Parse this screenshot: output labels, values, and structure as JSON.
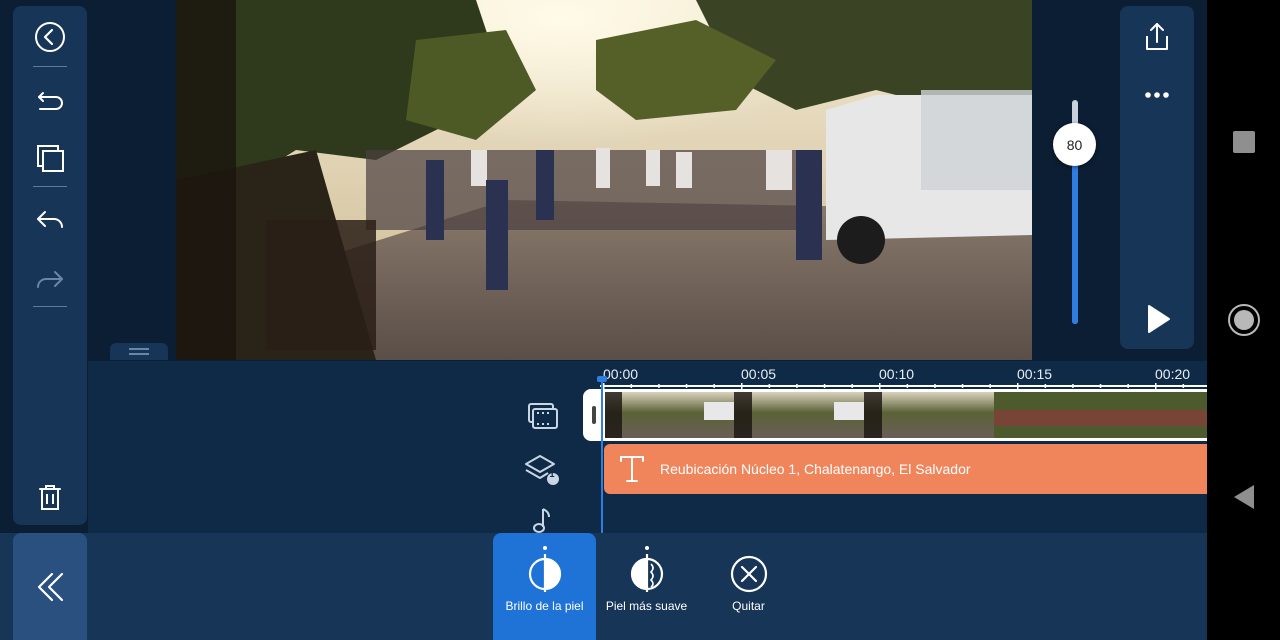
{
  "editor": {
    "left_toolbar": {
      "icons": [
        "back-circle-icon",
        "undo-icon",
        "duplicate-icon",
        "reply-icon",
        "redo-icon",
        "trash-icon"
      ]
    },
    "volume_slider": {
      "value": "80",
      "level_percent": 80
    },
    "right_toolbar": {
      "icons": [
        "share-export-icon",
        "more-options-icon",
        "play-icon"
      ]
    },
    "timeline": {
      "ruler_labels": [
        "00:00",
        "00:05",
        "00:10",
        "00:15",
        "00:20"
      ],
      "track_icons": [
        "media-track-icon",
        "layer-track-icon",
        "music-track-icon"
      ],
      "layer_badge": "1",
      "text_clip_label": "Reubicación Núcleo 1, Chalatenango, El Salvador"
    },
    "bottom_tools": [
      {
        "label": "Brillo de la piel",
        "icon": "skin-brightness-icon",
        "active": true
      },
      {
        "label": "Piel más suave",
        "icon": "skin-smooth-icon",
        "active": false
      },
      {
        "label": "Quitar",
        "icon": "remove-circle-icon",
        "active": false
      }
    ],
    "colors": {
      "panel": "#173556",
      "accent": "#1f73d6",
      "text_clip": "#f0855c",
      "playhead": "#2f7de1"
    }
  },
  "android_nav": {
    "icons": [
      "recents-square-icon",
      "home-circle-icon",
      "back-triangle-icon"
    ]
  }
}
